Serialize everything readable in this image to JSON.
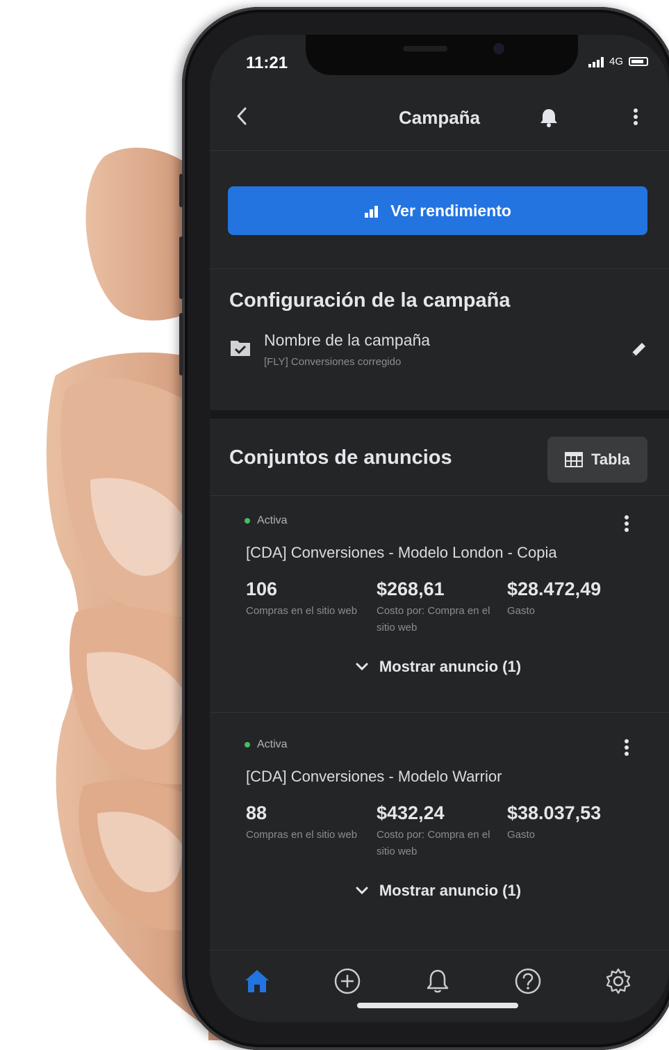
{
  "status_bar": {
    "time": "11:21",
    "network": "4G"
  },
  "header": {
    "title": "Campaña",
    "back_icon": "chevron-left-icon",
    "bell_icon": "bell-icon",
    "menu_icon": "more-vertical-icon"
  },
  "performance_button": {
    "label": "Ver rendimiento",
    "icon": "bar-chart-icon",
    "color": "#2374e1"
  },
  "campaign_settings": {
    "title": "Configuración de la campaña",
    "name_label": "Nombre de la campaña",
    "name_value": "[FLY] Conversiones corregido"
  },
  "ad_sets": {
    "title": "Conjuntos de anuncios",
    "table_button_label": "Tabla",
    "items": [
      {
        "status": "Activa",
        "name": "[CDA] Conversiones - Modelo London - Copia",
        "metrics": [
          {
            "value": "106",
            "label": "Compras en el sitio web"
          },
          {
            "value": "$268,61",
            "label": "Costo por: Compra en el sitio web"
          },
          {
            "value": "$28.472,49",
            "label": "Gasto"
          }
        ],
        "show_ads_label": "Mostrar anuncio (1)"
      },
      {
        "status": "Activa",
        "name": "[CDA] Conversiones - Modelo Warrior",
        "metrics": [
          {
            "value": "88",
            "label": "Compras en el sitio web"
          },
          {
            "value": "$432,24",
            "label": "Costo por: Compra en el sitio web"
          },
          {
            "value": "$38.037,53",
            "label": "Gasto"
          }
        ],
        "show_ads_label": "Mostrar anuncio (1)"
      }
    ]
  },
  "tab_bar": {
    "items": [
      "home-icon",
      "plus-circle-icon",
      "bell-outline-icon",
      "help-circle-icon",
      "settings-gear-icon"
    ],
    "active_color": "#2374e1"
  },
  "colors": {
    "status_active": "#45bd62",
    "background": "#242526"
  }
}
